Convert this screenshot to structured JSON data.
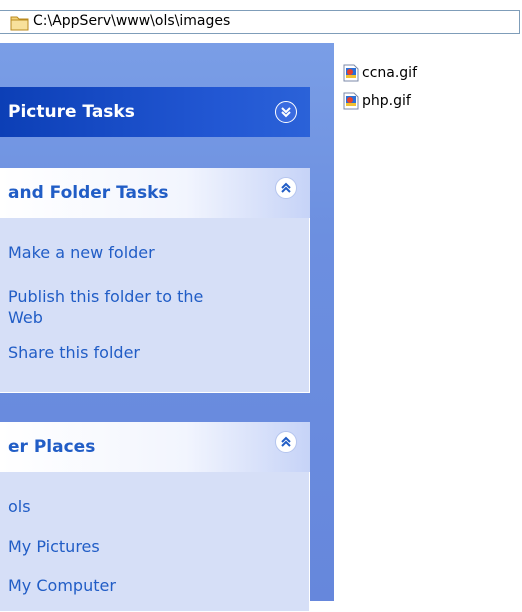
{
  "address": {
    "path": "C:\\AppServ\\www\\ols\\images"
  },
  "panels": [
    {
      "title": "Picture Tasks",
      "state": "collapsed",
      "links": []
    },
    {
      "title": "and Folder Tasks",
      "state": "expanded",
      "links": [
        "Make a new folder",
        "Publish this folder to the",
        "Web",
        "Share this folder"
      ]
    },
    {
      "title": "er Places",
      "state": "expanded",
      "links": [
        "ols",
        "My Pictures",
        "My Computer"
      ]
    }
  ],
  "files": [
    {
      "name": "ccna.gif",
      "icon": "gif-file-icon"
    },
    {
      "name": "php.gif",
      "icon": "gif-file-icon"
    }
  ],
  "colors": {
    "task_pane_bg": "#6c8fe0",
    "panel_body": "#d6dff7",
    "link": "#215dc6",
    "dark_header": "#0c3fb6"
  }
}
